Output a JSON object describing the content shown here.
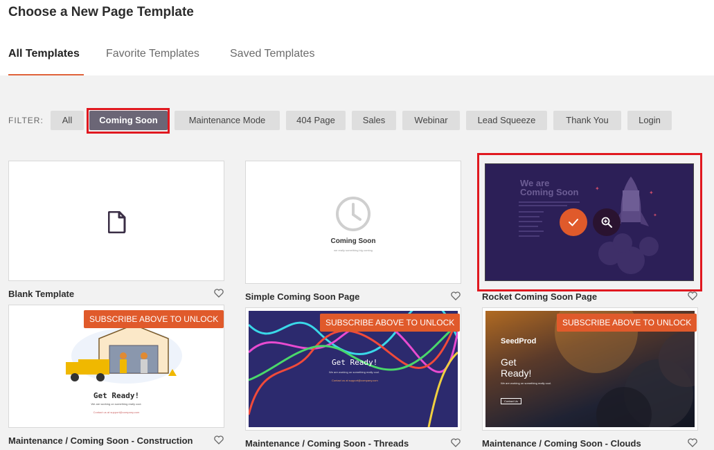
{
  "header": {
    "title": "Choose a New Page Template"
  },
  "tabs": [
    {
      "label": "All Templates",
      "active": true
    },
    {
      "label": "Favorite Templates",
      "active": false
    },
    {
      "label": "Saved Templates",
      "active": false
    }
  ],
  "filter": {
    "label": "FILTER:",
    "chips": [
      {
        "label": "All"
      },
      {
        "label": "Coming Soon",
        "selected": true
      },
      {
        "label": "Maintenance Mode"
      },
      {
        "label": "404 Page"
      },
      {
        "label": "Sales"
      },
      {
        "label": "Webinar"
      },
      {
        "label": "Lead Squeeze"
      },
      {
        "label": "Thank You"
      },
      {
        "label": "Login"
      }
    ]
  },
  "lock_label": "SUBSCRIBE ABOVE TO UNLOCK",
  "templates": [
    {
      "title": "Blank Template",
      "icon": "document-icon"
    },
    {
      "title": "Simple Coming Soon Page",
      "icon": "clock-icon",
      "thumb_heading": "Coming Soon",
      "thumb_sub": "we really something big coming"
    },
    {
      "title": "Rocket Coming Soon Page",
      "thumb_heading_1": "We are",
      "thumb_heading_2": "Coming Soon",
      "icon": "rocket-icon"
    },
    {
      "title": "Maintenance / Coming Soon - Construction",
      "thumb_heading": "Get Ready!",
      "thumb_sub": "We are working on something really cool.",
      "thumb_contact": "Contact us at support@company.com",
      "locked": true
    },
    {
      "title": "Maintenance / Coming Soon - Threads",
      "thumb_heading": "Get Ready!",
      "thumb_sub": "We are working on something really cool.",
      "thumb_contact": "Contact us at support@company.com",
      "locked": true
    },
    {
      "title": "Maintenance / Coming Soon - Clouds",
      "thumb_brand": "SeedProd",
      "thumb_heading_1": "Get",
      "thumb_heading_2": "Ready!",
      "thumb_sub": "We are working on something really cool.",
      "thumb_button": "Contact Us",
      "locked": true
    }
  ],
  "colors": {
    "accent": "#e05a2b",
    "highlight": "#e0181f",
    "selected_chip": "#6b6676"
  }
}
